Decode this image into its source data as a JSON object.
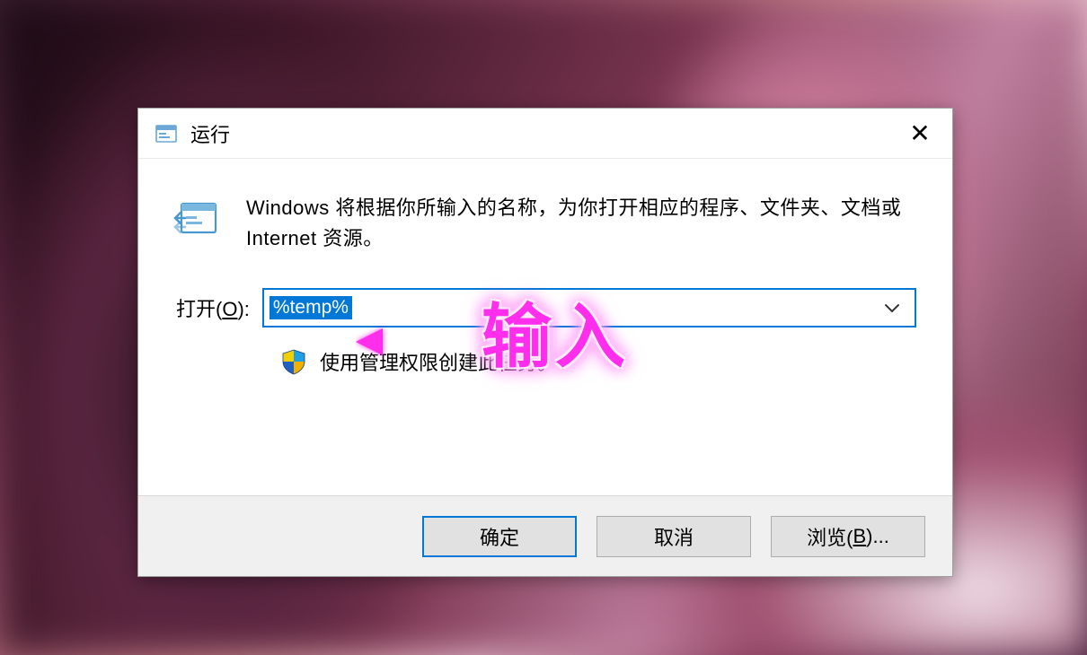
{
  "dialog": {
    "title": "运行",
    "description": "Windows 将根据你所输入的名称，为你打开相应的程序、文件夹、文档或 Internet 资源。",
    "open_label_prefix": "打开(",
    "open_label_accel": "O",
    "open_label_suffix": "):",
    "input_value": "%temp%",
    "admin_note": "使用管理权限创建此任务。",
    "buttons": {
      "ok": "确定",
      "cancel": "取消",
      "browse_prefix": "浏览(",
      "browse_accel": "B",
      "browse_suffix": ")..."
    }
  },
  "annotation": {
    "text": "输入"
  }
}
